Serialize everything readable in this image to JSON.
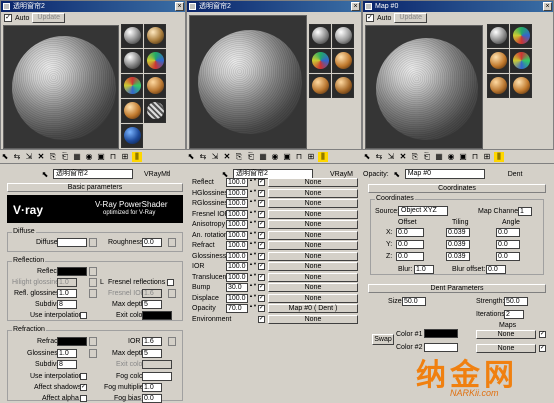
{
  "windows": [
    {
      "title": "透明窗帘2"
    },
    {
      "title": "透明窗帘2"
    },
    {
      "title": "Map #0"
    }
  ],
  "auto_label": "Auto",
  "update_label": "Update",
  "left": {
    "material_name": "透明窗帘2",
    "material_type": "VRayMtl",
    "basic_params": "Basic parameters",
    "vray_logo": "V·ray",
    "vray_title": "V-Ray PowerShader",
    "vray_sub": "optimized for V-Ray",
    "diffuse_group": "Diffuse",
    "diffuse": "Diffuse",
    "roughness": "Roughness",
    "roughness_val": "0.0",
    "reflection_group": "Reflection",
    "reflect": "Reflect",
    "hilight": "Hilight glossiness",
    "hilight_val": "1.0",
    "refl_gloss": "Refl. glossiness",
    "refl_gloss_val": "1.0",
    "subdivs": "Subdivs",
    "subdivs_val": "8",
    "use_interp": "Use interpolation",
    "l_label": "L",
    "fresnel": "Fresnel reflections",
    "fresnel_ior": "Fresnel IOR",
    "fresnel_ior_val": "1.6",
    "max_depth": "Max depth",
    "max_depth_val": "5",
    "exit_color": "Exit color",
    "refraction_group": "Refraction",
    "refract": "Refract",
    "ior": "IOR",
    "ior_val": "1.6",
    "glossiness": "Glossiness",
    "glossiness_val": "1.0",
    "r_max_depth": "Max depth",
    "r_max_depth_val": "5",
    "r_subdivs": "Subdivs",
    "r_subdivs_val": "8",
    "r_exit_color": "Exit color",
    "r_use_interp": "Use interpolation",
    "fog_color": "Fog color",
    "affect_shadows": "Affect shadows",
    "fog_mult": "Fog multiplier",
    "fog_mult_val": "1.0",
    "affect_alpha": "Affect alpha",
    "fog_bias": "Fog bias",
    "fog_bias_val": "0.0"
  },
  "middle": {
    "material_name": "透明窗帘2",
    "material_type": "VRayM",
    "rows": [
      {
        "name": "Reflect",
        "val": "100.0",
        "map": "None"
      },
      {
        "name": "HGlossiness",
        "val": "100.0",
        "map": "None"
      },
      {
        "name": "RGlossiness",
        "val": "100.0",
        "map": "None"
      },
      {
        "name": "Fresnel IOR",
        "val": "100.0",
        "map": "None"
      },
      {
        "name": "Anisotropy",
        "val": "100.0",
        "map": "None"
      },
      {
        "name": "An. rotation",
        "val": "100.0",
        "map": "None"
      },
      {
        "name": "Refract",
        "val": "100.0",
        "map": "None"
      },
      {
        "name": "Glossiness",
        "val": "100.0",
        "map": "None"
      },
      {
        "name": "IOR",
        "val": "100.0",
        "map": "None"
      },
      {
        "name": "Translucent",
        "val": "100.0",
        "map": "None"
      },
      {
        "name": "Bump",
        "val": "30.0",
        "map": "None"
      },
      {
        "name": "Displace",
        "val": "100.0",
        "map": "None"
      },
      {
        "name": "Opacity",
        "val": "70.0",
        "map": "Map #0  ( Dent )"
      },
      {
        "name": "Environment",
        "val": "",
        "map": "None"
      }
    ]
  },
  "right": {
    "opacity_label": "Opacity:",
    "map_name": "Map #0",
    "map_type": "Dent",
    "coordinates_hdr": "Coordinates",
    "coordinates_group": "Coordinates",
    "source": "Source:",
    "source_val": "Object XYZ",
    "map_channel": "Map Channel:",
    "map_channel_val": "1",
    "offset": "Offset",
    "tiling": "Tiling",
    "angle": "Angle",
    "x": "X:",
    "y": "Y:",
    "z": "Z:",
    "offset_vals": [
      "0.0",
      "0.0",
      "0.0"
    ],
    "tiling_vals": [
      "0.039",
      "0.039",
      "0.039"
    ],
    "angle_vals": [
      "0.0",
      "0.0",
      "0.0"
    ],
    "blur": "Blur:",
    "blur_val": "1.0",
    "blur_offset": "Blur offset:",
    "blur_offset_val": "0.0",
    "dent_hdr": "Dent Parameters",
    "size": "Size:",
    "size_val": "50.0",
    "strength": "Strength:",
    "strength_val": "50.0",
    "iterations": "Iterations:",
    "iterations_val": "2",
    "maps": "Maps",
    "swap": "Swap",
    "color1": "Color #1",
    "color2": "Color #2",
    "none": "None"
  },
  "watermark": {
    "cn": "纳金网",
    "en": "NARKii.com"
  }
}
